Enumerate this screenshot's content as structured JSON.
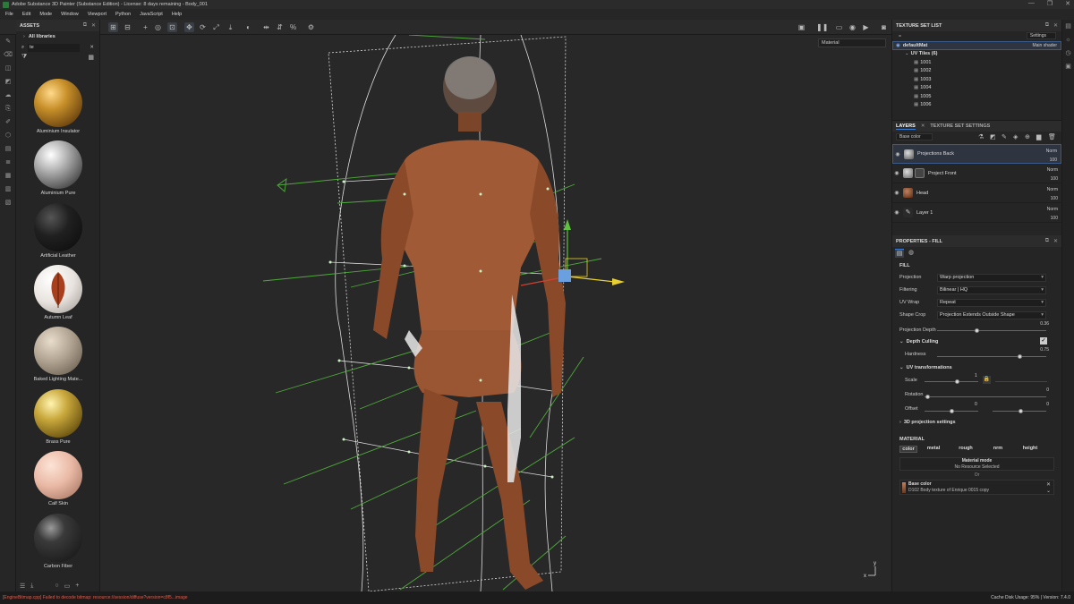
{
  "window": {
    "title": "Adobe Substance 3D Painter (Substance Edition) - License: 8 days remaining - Body_001",
    "controls": [
      "—",
      "❐",
      "✕"
    ]
  },
  "menu": [
    "File",
    "Edit",
    "Mode",
    "Window",
    "Viewport",
    "Python",
    "JavaScript",
    "Help"
  ],
  "assets": {
    "title": "ASSETS",
    "library": "All libraries",
    "search_value": "te",
    "items": [
      {
        "label": "Aluminium Insulator",
        "color": "#c8902a"
      },
      {
        "label": "Aluminium Pure",
        "color": "#b5b5b5"
      },
      {
        "label": "Artificial Leather",
        "color": "#202020"
      },
      {
        "label": "Autumn Leaf",
        "color": "#e8e3de"
      },
      {
        "label": "Baked Lighting Mate...",
        "color": "#b0a290"
      },
      {
        "label": "Brass Pure",
        "color": "#c9a83c"
      },
      {
        "label": "Calf Skin",
        "color": "#e9b9a5"
      },
      {
        "label": "Carbon Fiber",
        "color": "#1f1f1f"
      }
    ]
  },
  "viewport": {
    "mode_dropdown": "Material",
    "axis_x": "x",
    "axis_y": "y"
  },
  "texture_set_list": {
    "title": "TEXTURE SET LIST",
    "settings_label": "Settings",
    "set_name": "defaultMat",
    "shader": "Main shader",
    "uv_tiles_label": "UV Tiles (6)",
    "tiles": [
      "1001",
      "1002",
      "1003",
      "1004",
      "1005",
      "1006"
    ]
  },
  "layers_panel": {
    "tab_layers": "LAYERS",
    "tab_settings": "TEXTURE SET SETTINGS",
    "channel": "Base color",
    "layers": [
      {
        "name": "Projections Back",
        "blend": "Norm",
        "opacity": "100",
        "color": "#6a6a6a"
      },
      {
        "name": "Project Front",
        "blend": "Norm",
        "opacity": "100",
        "color": "#7a7a7a"
      },
      {
        "name": "Head",
        "blend": "Norm",
        "opacity": "100",
        "color": "#8b5a3c"
      },
      {
        "name": "Layer 1",
        "blend": "Norm",
        "opacity": "100",
        "color": "#3a3a3a"
      }
    ]
  },
  "properties": {
    "title": "PROPERTIES - FILL",
    "section_fill": "FILL",
    "projection_label": "Projection",
    "projection_value": "Warp projection",
    "filtering_label": "Filtering",
    "filtering_value": "Bilinear | HQ",
    "uvwrap_label": "UV Wrap",
    "uvwrap_value": "Repeat",
    "shapecrop_label": "Shape Crop",
    "shapecrop_value": "Projection Extends Outside Shape",
    "projdepth_label": "Projection Depth",
    "projdepth_value": "0.36",
    "depthculling_label": "Depth Culling",
    "hardness_label": "Hardness",
    "hardness_value": "0.75",
    "uvtrans_label": "UV transformations",
    "scale_label": "Scale",
    "scale_value": "1",
    "rotation_label": "Rotation",
    "rotation_value": "0",
    "offset_label": "Offset",
    "offset_value1": "0",
    "offset_value2": "0",
    "proj3d_label": "3D projection settings",
    "section_material": "MATERIAL",
    "mat_channels": [
      "color",
      "metal",
      "rough",
      "nrm",
      "height"
    ],
    "material_mode_label": "Material mode",
    "material_mode_value": "No Resource Selected",
    "or_label": "Or",
    "basecolor_label": "Base color",
    "basecolor_value": "D102 Body texture of Enrique 0015 copy"
  },
  "statusbar": {
    "error": "[EngineBitmap.cpp] Failed to decode bitmap: resource://session/diffuse?version=c8f5...image",
    "cache": "Cache Disk Usage:  95%  |  Version: 7.4.0"
  }
}
